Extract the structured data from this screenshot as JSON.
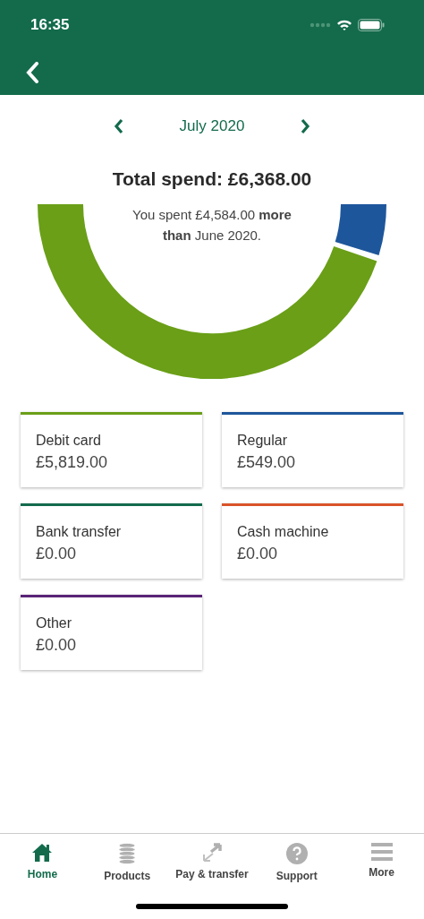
{
  "status_bar": {
    "time": "16:35"
  },
  "month_nav": {
    "label": "July 2020"
  },
  "total": "Total spend: £6,368.00",
  "comparison": "You spent £4,584.00 **more** **than** June 2020.",
  "categories": [
    {
      "name": "Debit card",
      "amount": "£5,819.00",
      "color": "#6a9f17"
    },
    {
      "name": "Regular",
      "amount": "£549.00",
      "color": "#1e569b"
    },
    {
      "name": "Bank transfer",
      "amount": "£0.00",
      "color": "#136b4c"
    },
    {
      "name": "Cash machine",
      "amount": "£0.00",
      "color": "#d9532a"
    },
    {
      "name": "Other",
      "amount": "£0.00",
      "color": "#5a2478"
    }
  ],
  "tabs": [
    {
      "label": "Home",
      "kind": "home",
      "selected": true
    },
    {
      "label": "Products",
      "kind": "coins",
      "selected": false
    },
    {
      "label": "Pay & transfer",
      "kind": "transfer",
      "selected": false
    },
    {
      "label": "Support",
      "kind": "help",
      "selected": false
    },
    {
      "label": "More",
      "kind": "menu",
      "selected": false
    }
  ]
}
